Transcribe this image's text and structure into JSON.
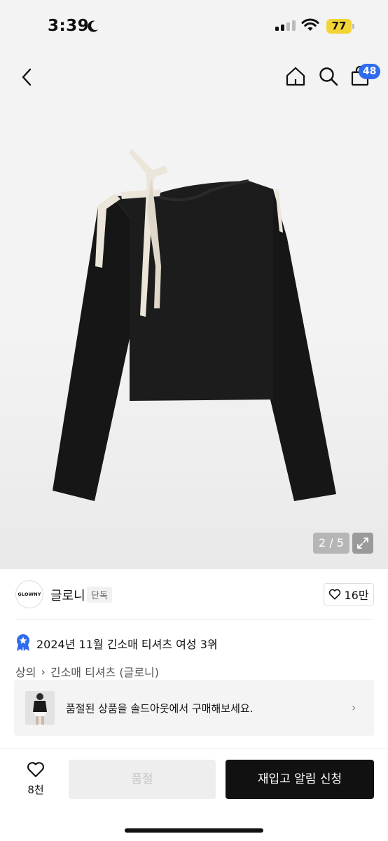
{
  "status_bar": {
    "time": "3:39",
    "battery": "77"
  },
  "nav": {
    "cart_count": "48"
  },
  "gallery": {
    "pager": "2 / 5"
  },
  "brand": {
    "logo_text": "GLOWNY",
    "name": "글로니",
    "tag": "단독",
    "likes": "16만"
  },
  "ranking": {
    "text": "2024년 11월 긴소매 티셔츠 여성 3위",
    "chevron": "›"
  },
  "breadcrumb": {
    "level1": "상의",
    "separator": "›",
    "level2": "긴소매 티셔츠 (글로니)"
  },
  "soldout_banner": {
    "text": "품절된 상품을 솔드아웃에서 구매해보세요.",
    "chevron": "›"
  },
  "bottom_bar": {
    "wish_count": "8천",
    "soldout_label": "품절",
    "restock_label": "재입고 알림 신청"
  },
  "colors": {
    "accent": "#2f6bef",
    "cta": "#111111",
    "battery": "#f2d435"
  }
}
